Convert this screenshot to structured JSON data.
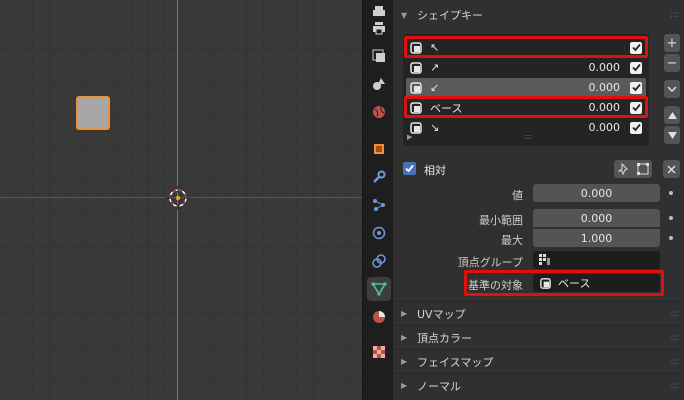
{
  "panel": {
    "shape_keys_title": "シェイプキー",
    "shape_keys": [
      {
        "name": "↖",
        "value": "",
        "checked": true
      },
      {
        "name": "↗",
        "value": "0.000",
        "checked": true
      },
      {
        "name": "↙",
        "value": "0.000",
        "checked": true
      },
      {
        "name": "ベース",
        "value": "0.000",
        "checked": true
      },
      {
        "name": "↘",
        "value": "0.000",
        "checked": true
      }
    ],
    "buttons": {
      "add": "+",
      "remove": "−"
    },
    "relative_label": "相対",
    "value_label": "値",
    "value": "0.000",
    "range_min_label": "最小範囲",
    "range_min": "0.000",
    "max_label": "最大",
    "max": "1.000",
    "vertex_group_label": "頂点グループ",
    "relative_to_label": "基準の対象",
    "relative_to_value": "ベース",
    "collapsed_sections": [
      "UVマップ",
      "頂点カラー",
      "フェイスマップ",
      "ノーマル"
    ]
  },
  "colors": {
    "highlight": "#e01010",
    "accent": "#4772b3",
    "selection_outline": "#f0913a",
    "active_tab_icon": "#4fc3a0"
  }
}
